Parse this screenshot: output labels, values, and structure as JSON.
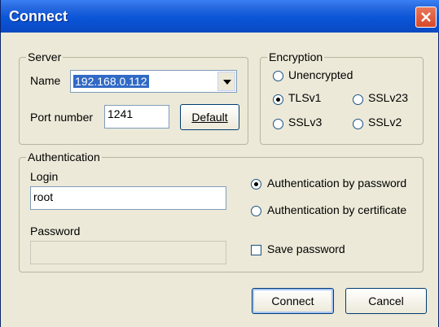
{
  "window": {
    "title": "Connect"
  },
  "server": {
    "legend": "Server",
    "name_label": "Name",
    "name_value": "192.168.0.112",
    "port_label": "Port number",
    "port_value": "1241",
    "default_button": "Default"
  },
  "encryption": {
    "legend": "Encryption",
    "selected": "TLSv1",
    "options": [
      "Unencrypted",
      "TLSv1",
      "SSLv23",
      "SSLv3",
      "SSLv2"
    ]
  },
  "authentication": {
    "legend": "Authentication",
    "login_label": "Login",
    "login_value": "root",
    "password_label": "Password",
    "password_value": "",
    "by_password_label": "Authentication by password",
    "by_certificate_label": "Authentication by certificate",
    "selected": "Authentication by password",
    "save_password_label": "Save password",
    "save_password_checked": false
  },
  "buttons": {
    "connect": "Connect",
    "cancel": "Cancel"
  }
}
